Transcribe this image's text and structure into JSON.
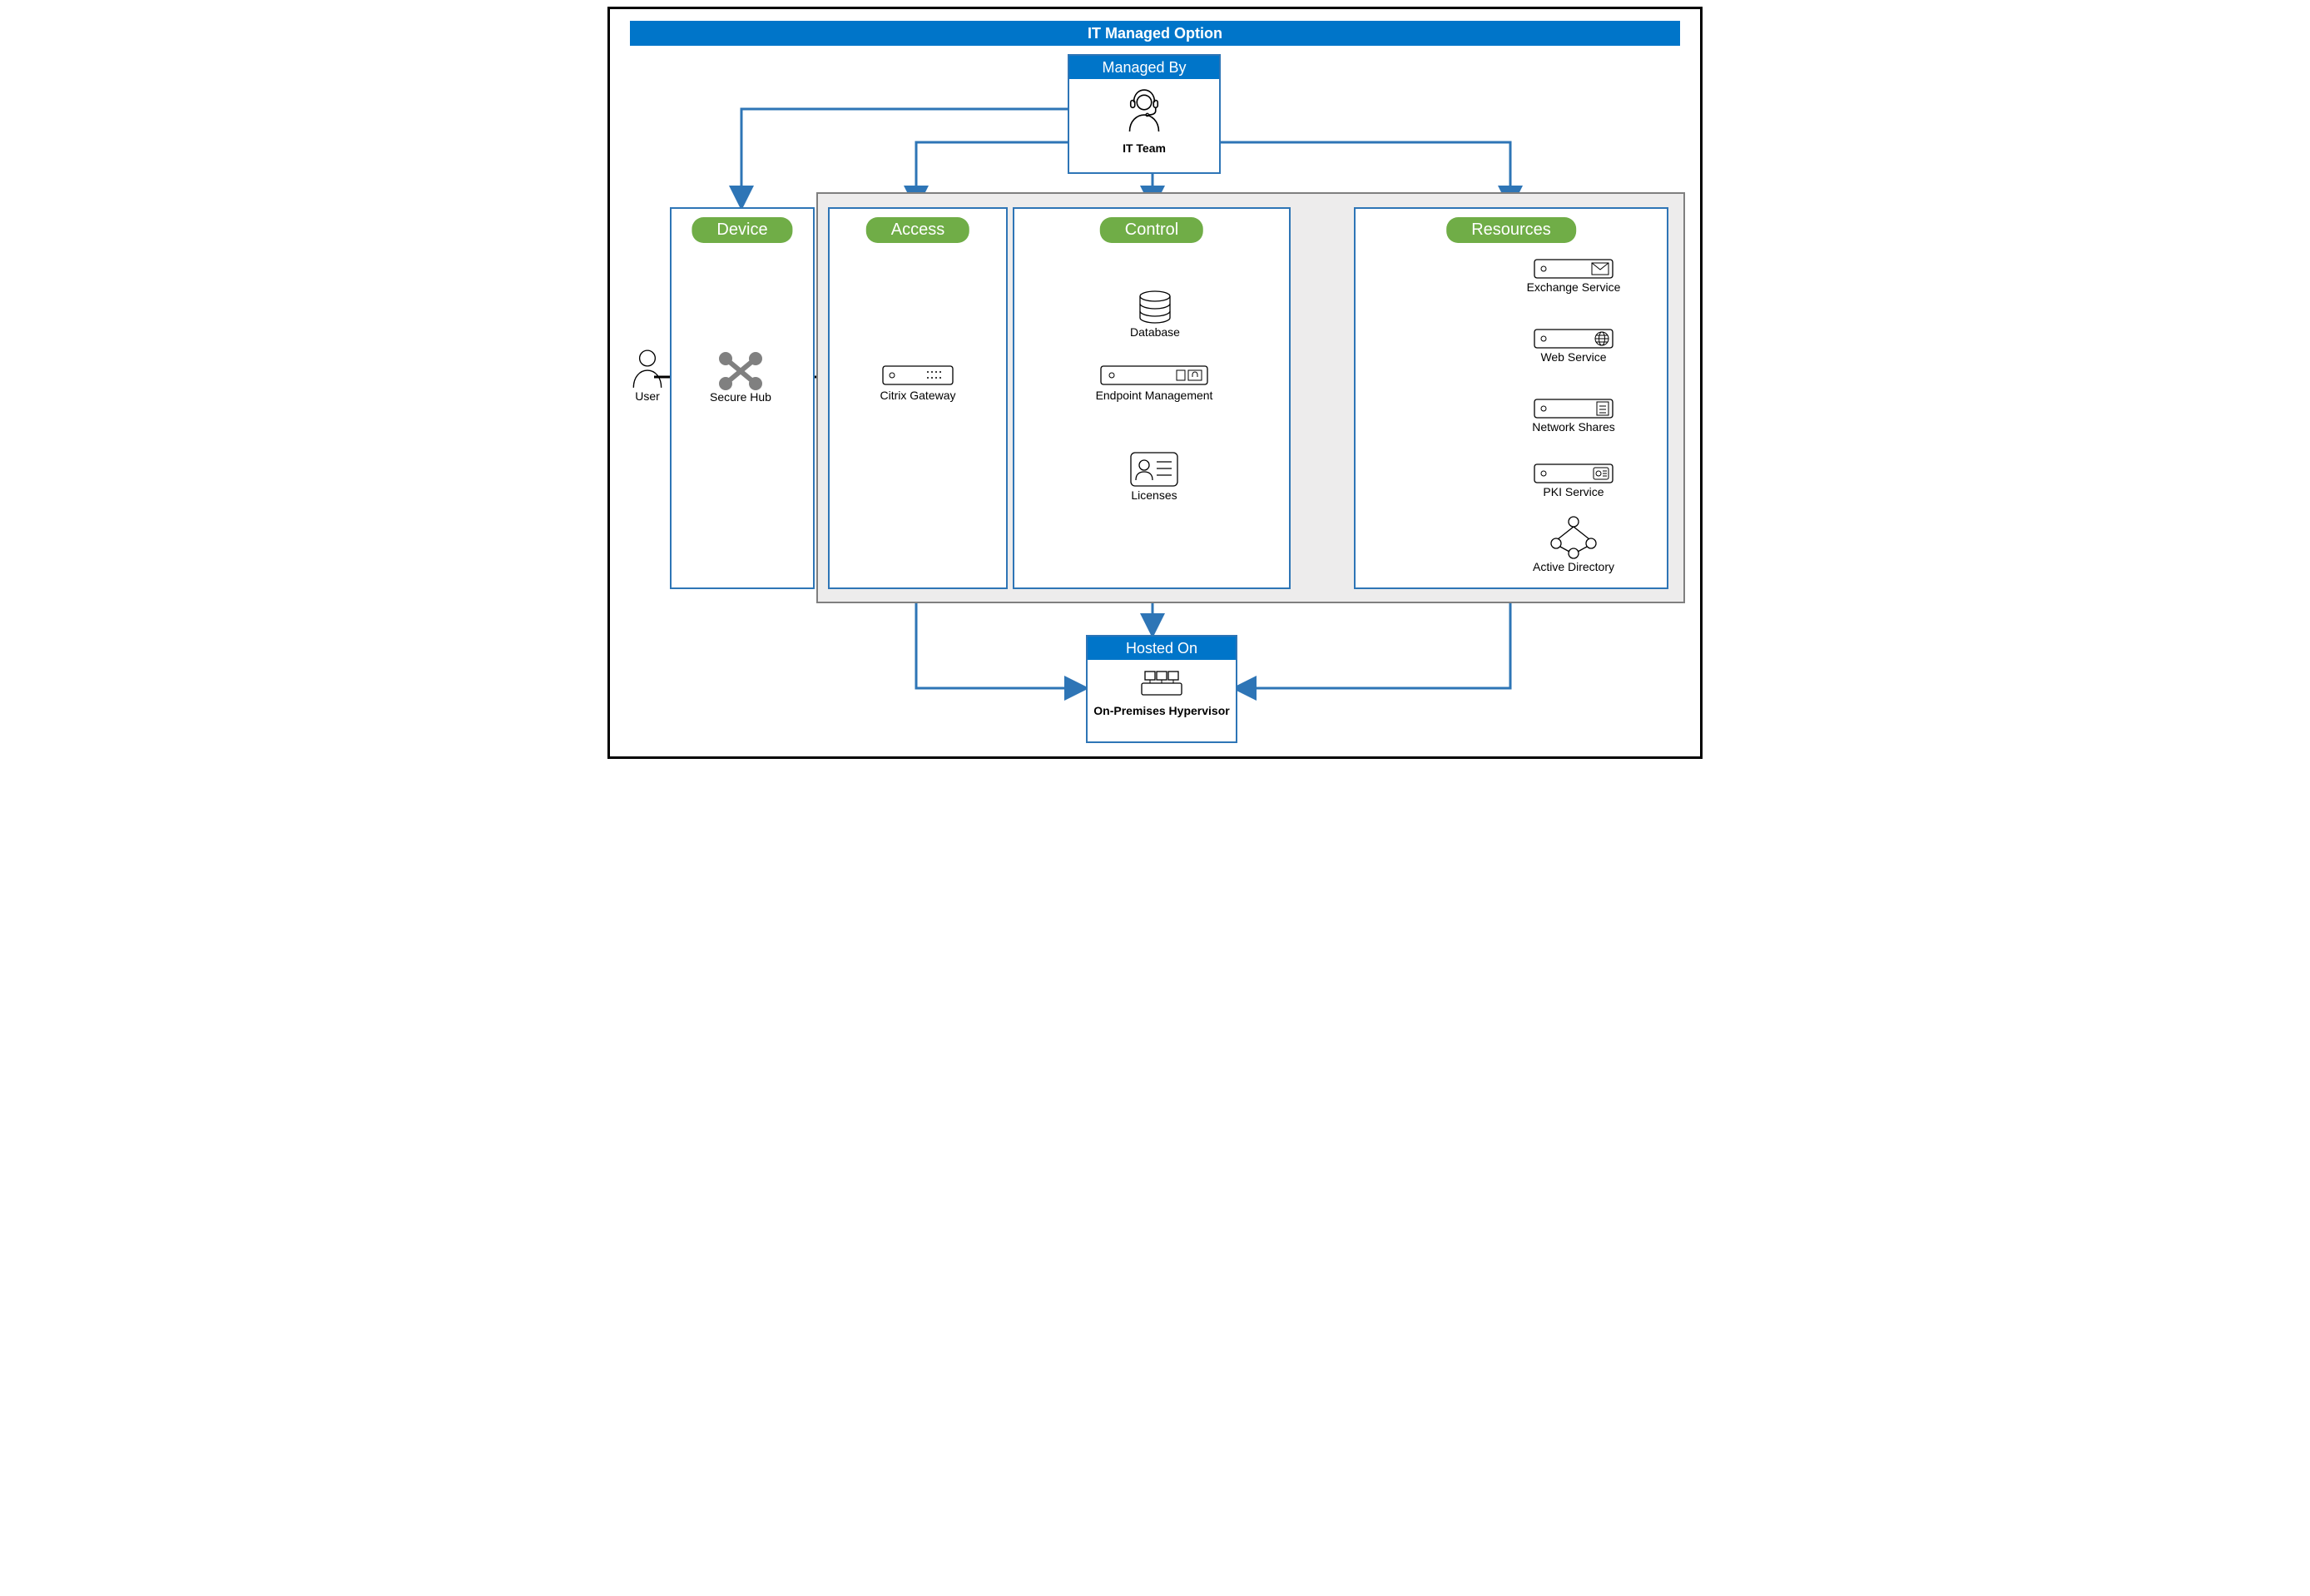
{
  "title": "IT Managed Option",
  "managed_by": {
    "header": "Managed By",
    "label": "IT Team"
  },
  "hosted_on": {
    "header": "Hosted On",
    "label": "On-Premises Hypervisor"
  },
  "user": "User",
  "device": {
    "title": "Device",
    "securehub": "Secure Hub"
  },
  "access": {
    "title": "Access",
    "gateway": "Citrix Gateway"
  },
  "control": {
    "title": "Control",
    "database": "Database",
    "endpoint": "Endpoint Management",
    "licenses": "Licenses"
  },
  "resources": {
    "title": "Resources",
    "exchange": "Exchange Service",
    "web": "Web Service",
    "shares": "Network Shares",
    "pki": "PKI Service",
    "ad": "Active Directory"
  }
}
